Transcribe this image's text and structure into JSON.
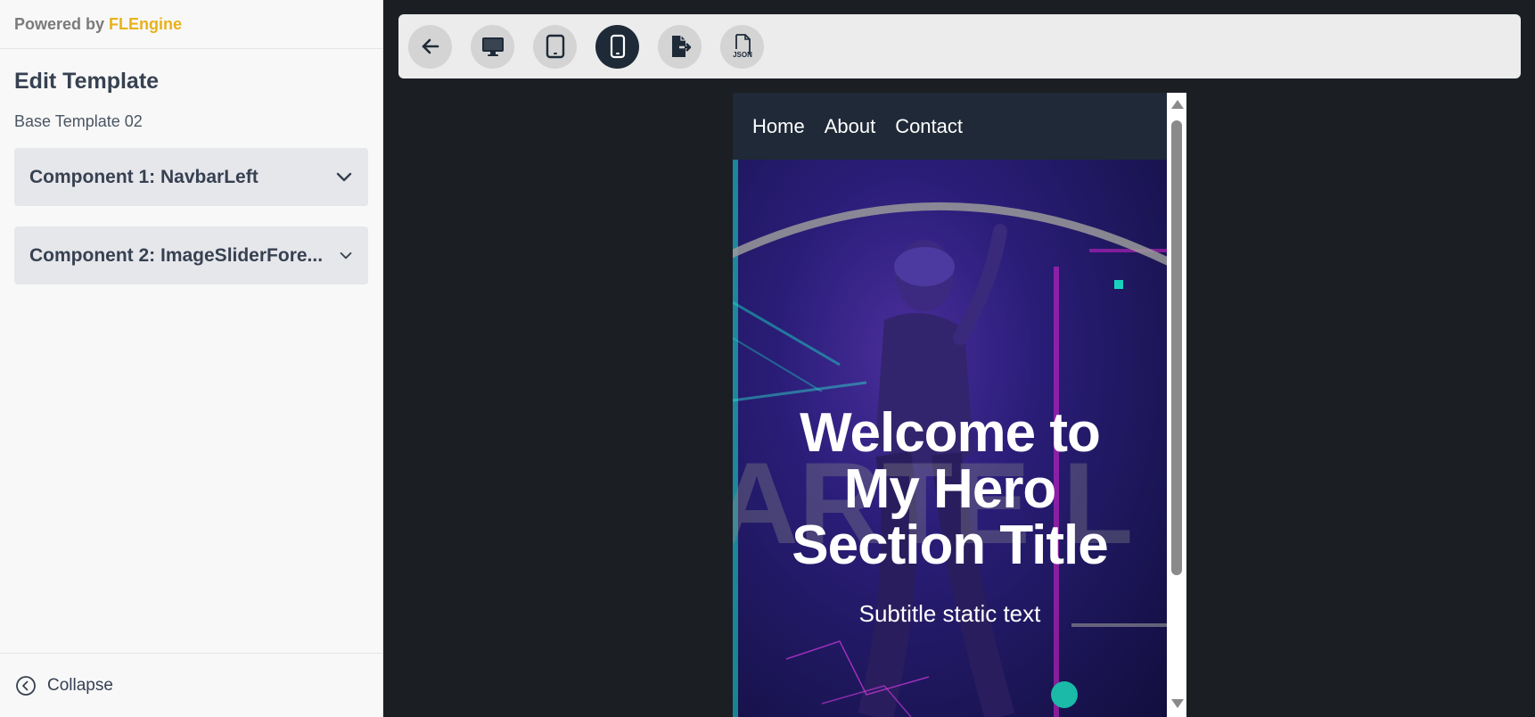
{
  "sidebar": {
    "powered_by": "Powered by",
    "brand": "FLEngine",
    "heading": "Edit Template",
    "template_name": "Base Template 02",
    "components": [
      {
        "label": "Component 1: NavbarLeft",
        "icon": "chevron-down-icon"
      },
      {
        "label": "Component 2: ImageSliderFore...",
        "icon": "chevron-down-icon"
      }
    ],
    "collapse_label": "Collapse"
  },
  "toolbar": {
    "buttons": [
      {
        "name": "back",
        "icon": "arrow-left-icon",
        "active": false
      },
      {
        "name": "desktop",
        "icon": "monitor-icon",
        "active": false
      },
      {
        "name": "tablet",
        "icon": "tablet-icon",
        "active": false
      },
      {
        "name": "mobile",
        "icon": "smartphone-icon",
        "active": true
      },
      {
        "name": "export",
        "icon": "file-export-icon",
        "active": false
      },
      {
        "name": "json",
        "icon": "json-file-icon",
        "label": "JSON",
        "active": false
      }
    ]
  },
  "preview": {
    "nav_links": [
      "Home",
      "About",
      "Contact"
    ],
    "hero_title_lines": [
      "Welcome to",
      "My Hero",
      "Section Title"
    ],
    "hero_subtitle": "Subtitle static text"
  },
  "colors": {
    "brand": "#e8b21a",
    "active_button": "#1e2a38",
    "canvas_bg": "#1b1f24",
    "preview_nav_bg": "#1f2937"
  }
}
